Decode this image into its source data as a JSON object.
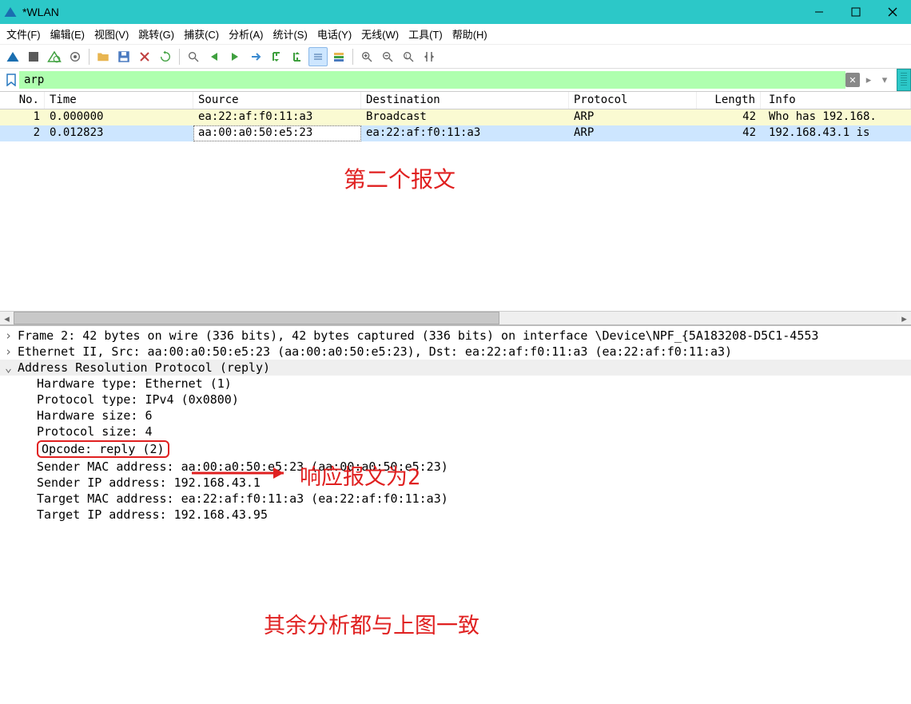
{
  "window": {
    "title": "*WLAN"
  },
  "menu": {
    "file": "文件(F)",
    "edit": "编辑(E)",
    "view": "视图(V)",
    "go": "跳转(G)",
    "capture": "捕获(C)",
    "analyze": "分析(A)",
    "stats": "统计(S)",
    "phone": "电话(Y)",
    "wireless": "无线(W)",
    "tools": "工具(T)",
    "help": "帮助(H)"
  },
  "filter": {
    "value": "arp"
  },
  "columns": {
    "no": "No.",
    "time": "Time",
    "src": "Source",
    "dst": "Destination",
    "proto": "Protocol",
    "len": "Length",
    "info": "Info"
  },
  "packets": [
    {
      "no": "1",
      "time": "0.000000",
      "src": "ea:22:af:f0:11:a3",
      "dst": "Broadcast",
      "proto": "ARP",
      "len": "42",
      "info": "Who has 192.168."
    },
    {
      "no": "2",
      "time": "0.012823",
      "src": "aa:00:a0:50:e5:23",
      "dst": "ea:22:af:f0:11:a3",
      "proto": "ARP",
      "len": "42",
      "info": "192.168.43.1 is "
    }
  ],
  "annotations": {
    "a1": "第二个报文",
    "a2": "响应报文为2",
    "a3": "其余分析都与上图一致"
  },
  "details": {
    "frame": "Frame 2: 42 bytes on wire (336 bits), 42 bytes captured (336 bits) on interface \\Device\\NPF_{5A183208-D5C1-4553",
    "eth": "Ethernet II, Src: aa:00:a0:50:e5:23 (aa:00:a0:50:e5:23), Dst: ea:22:af:f0:11:a3 (ea:22:af:f0:11:a3)",
    "arp": "Address Resolution Protocol (reply)",
    "hwtype": "Hardware type: Ethernet (1)",
    "ptype": "Protocol type: IPv4 (0x0800)",
    "hwsize": "Hardware size: 6",
    "psize": "Protocol size: 4",
    "opcode": "Opcode: reply (2)",
    "smac": "Sender MAC address: aa:00:a0:50:e5:23 (aa:00:a0:50:e5:23)",
    "sip": "Sender IP address: 192.168.43.1",
    "tmac": "Target MAC address: ea:22:af:f0:11:a3 (ea:22:af:f0:11:a3)",
    "tip": "Target IP address: 192.168.43.95"
  }
}
